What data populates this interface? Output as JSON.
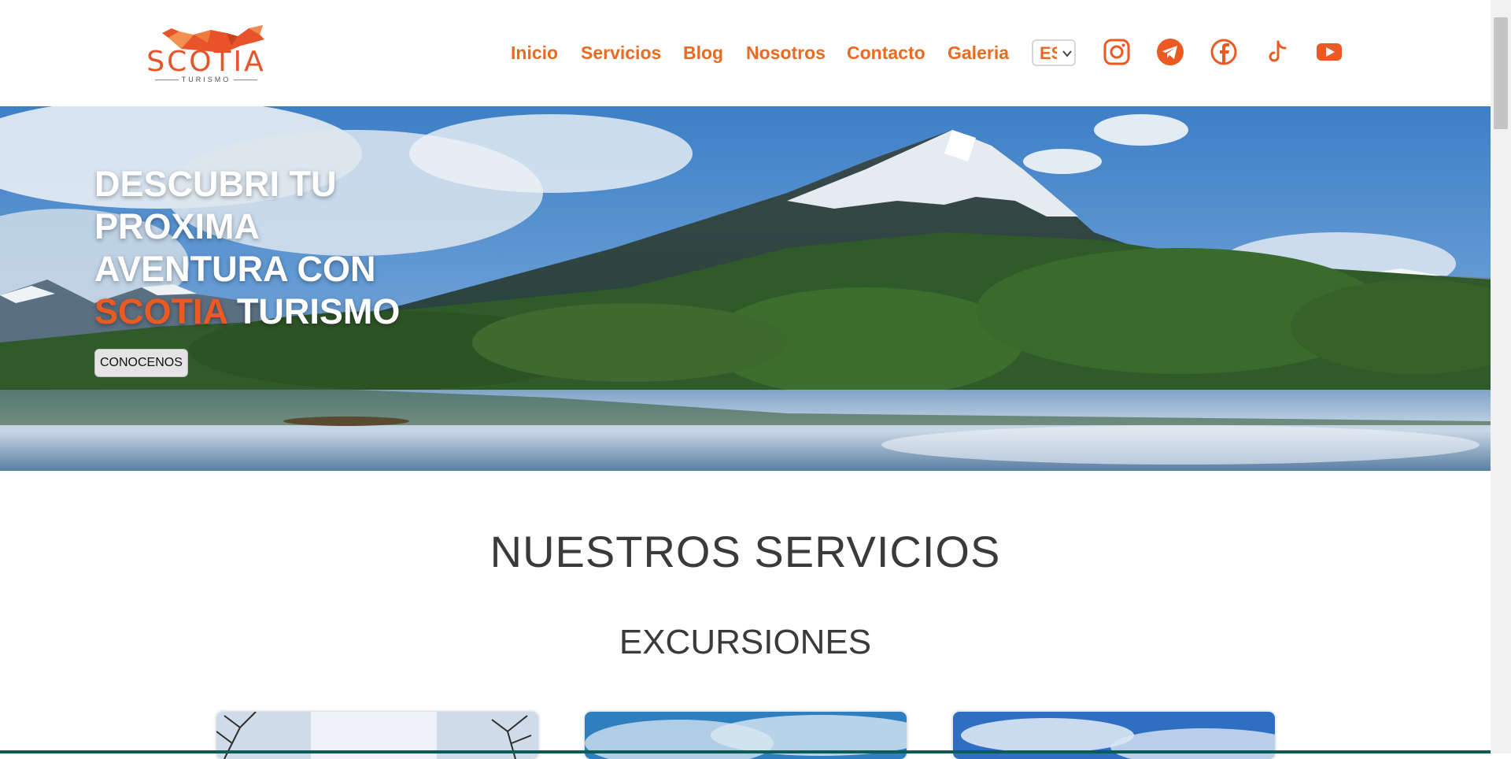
{
  "brand": {
    "name": "SCOTIA",
    "tagline": "TURISMO",
    "color": "#e8532a"
  },
  "nav": {
    "items": [
      "Inicio",
      "Servicios",
      "Blog",
      "Nosotros",
      "Contacto",
      "Galeria"
    ],
    "language": "ES",
    "social": [
      "instagram-icon",
      "telegram-icon",
      "facebook-icon",
      "tiktok-icon",
      "youtube-icon"
    ]
  },
  "hero": {
    "title_line1": "DESCUBRI TU",
    "title_line2": "PROXIMA",
    "title_line3": "AVENTURA CON",
    "title_accent": "SCOTIA",
    "title_end": "TURISMO",
    "button": "CONOCENOS"
  },
  "services": {
    "title": "NUESTROS SERVICIOS",
    "subtitle": "EXCURSIONES"
  },
  "colors": {
    "accent": "#ea6a22",
    "heading": "#3a3a3a"
  }
}
